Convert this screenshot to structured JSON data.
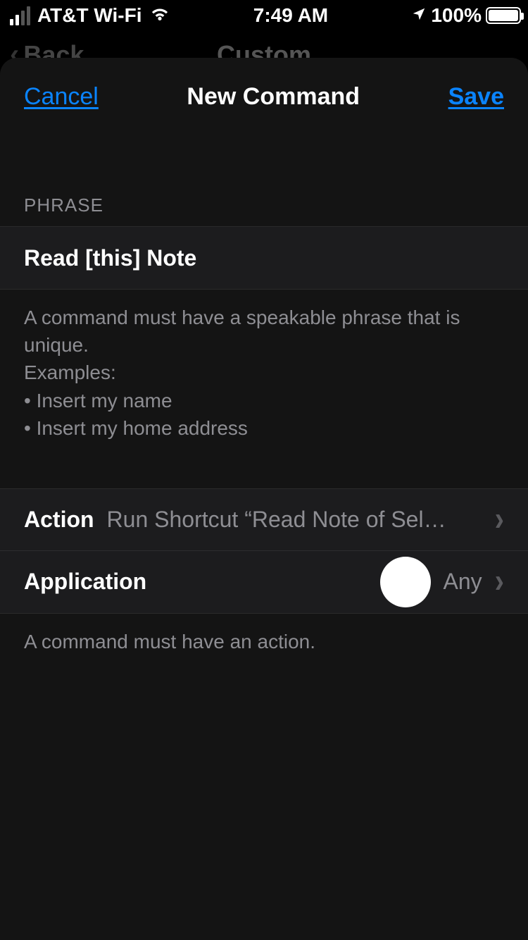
{
  "status": {
    "carrier": "AT&T Wi-Fi",
    "time": "7:49 AM",
    "battery_pct": "100%"
  },
  "underlying": {
    "back": "Back",
    "title": "Custom"
  },
  "modal": {
    "cancel": "Cancel",
    "title": "New Command",
    "save": "Save"
  },
  "phrase": {
    "header": "PHRASE",
    "value": "Read [this] Note",
    "footer": "A command must have a speakable phrase that is unique.\nExamples:\n • Insert my name\n • Insert my home address"
  },
  "rows": {
    "action": {
      "label": "Action",
      "value": "Run Shortcut “Read Note of Sel…"
    },
    "application": {
      "label": "Application",
      "value": "Any"
    }
  },
  "action_footer": "A command must have an action."
}
